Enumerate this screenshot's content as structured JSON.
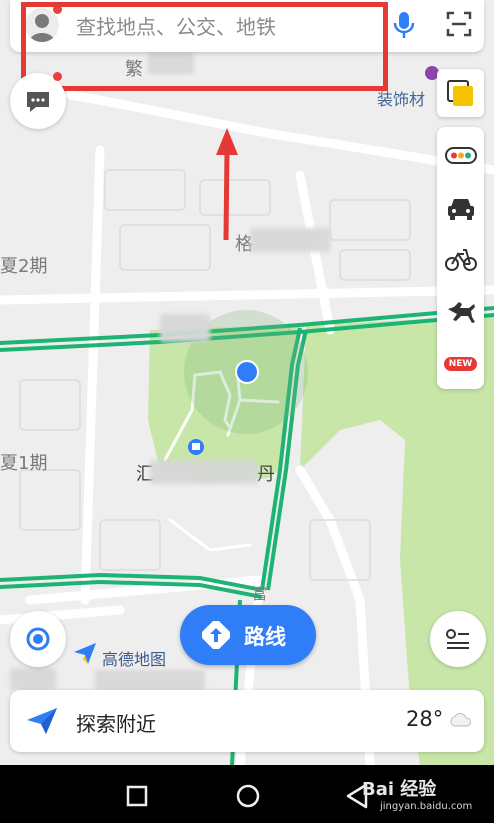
{
  "search": {
    "placeholder": "查找地点、公交、地铁"
  },
  "map": {
    "labels": {
      "top_partial": "繁",
      "decoration": "装饰材",
      "road_ge": "格",
      "xia2": "夏2期",
      "xia1": "夏1期",
      "poi_left": "汇",
      "poi_right": "丹",
      "fu": "富"
    }
  },
  "sidebar": {
    "items": [
      {
        "icon": "traffic-light-icon"
      },
      {
        "icon": "taxi-icon"
      },
      {
        "icon": "bicycle-icon"
      },
      {
        "icon": "horse-icon"
      },
      {
        "icon": "new-badge-icon",
        "label": "NEW"
      }
    ]
  },
  "route_button": {
    "label": "路线"
  },
  "logo": {
    "text": "高德地图"
  },
  "explore": {
    "label": "探索附近",
    "temperature": "28°",
    "weather_icon": "cloud-icon"
  },
  "watermark": {
    "title": "Bai 经验",
    "sub": "jingyan.baidu.com"
  },
  "colors": {
    "accent": "#2f7df7",
    "green_road": "#1db374",
    "park": "#c8e6a8",
    "highlight": "#e53935"
  }
}
